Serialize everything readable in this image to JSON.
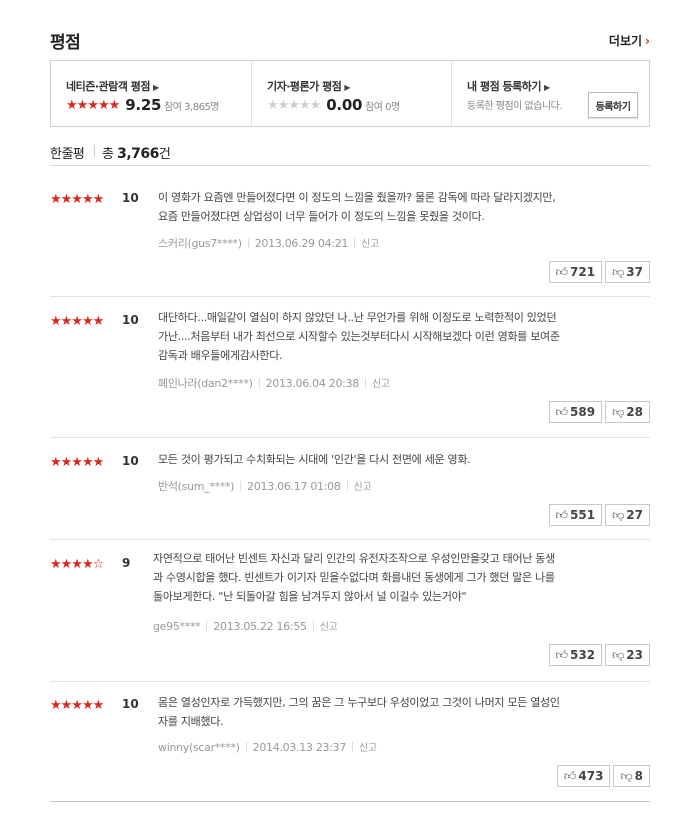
{
  "header": {
    "title": "평점",
    "more": "더보기",
    "more_chev": "›"
  },
  "summary": {
    "audience": {
      "label": "네티즌·관람객 평점",
      "stars": "★★★★★",
      "score": "9.25",
      "participants": "참여 3,865명"
    },
    "critic": {
      "label": "기자·평론가 평점",
      "stars": "★★★★★",
      "score": "0.00",
      "participants": "참여 0명"
    },
    "mine": {
      "label": "내 평점 등록하기",
      "text": "등록한 평점이 없습니다.",
      "button": "등록하기"
    },
    "chev": "›"
  },
  "count": {
    "label": "한줄평",
    "prefix": "총",
    "number": "3,766",
    "suffix": "건"
  },
  "reviews": [
    {
      "stars": "★★★★★",
      "score": "10",
      "lines": [
        "이 영화가 요즘엔 만들어졌다면 이 정도의 느낌을 줬을까? 물론 감독에 따라 달라지겠지만,",
        "요즘 만들어졌다면 상업성이 너무 들어가 이 정도의 느낌을 못줬을 것이다."
      ],
      "user": "스커리(gus7****)",
      "date": "2013.06.29 04:21",
      "report": "신고",
      "likes": "721",
      "dislikes": "37"
    },
    {
      "stars": "★★★★★",
      "score": "10",
      "lines": [
        "대단하다...매일같이 열심이 하지 않았던 나..난 무언가를 위해 이정도로 노력한적이 있었던",
        "가난....처음부터 내가 최선으로 시작할수 있는것부터다시 시작해보겠다 이런 영화를 보여준",
        "감독과 배우들에게감사한다."
      ],
      "user": "폐인나라(dan2****)",
      "date": "2013.06.04 20:38",
      "report": "신고",
      "likes": "589",
      "dislikes": "28"
    },
    {
      "stars": "★★★★★",
      "score": "10",
      "lines": [
        "모든 것이 평가되고 수치화되는 시대에 '인간'을 다시 전면에 세운 영화."
      ],
      "user": "반석(sum_****)",
      "date": "2013.06.17 01:08",
      "report": "신고",
      "likes": "551",
      "dislikes": "27"
    },
    {
      "stars": "★★★★☆",
      "score": "9",
      "lines": [
        "자연적으로 태어난 빈센트 자신과 달리 인간의 유전자조작으로 우성인만을갖고 태어난 동생",
        "과 수영시합을 했다. 빈센트가 이기자 믿을수없다며 화를내던 동생에게 그가 했던 말은 나를",
        "돌아보게한다. \"난 되돌아갈 힘을 남겨두지 않아서 널 이길수 있는거야\""
      ],
      "user": "ge95****",
      "date": "2013.05.22 16:55",
      "report": "신고",
      "likes": "532",
      "dislikes": "23"
    },
    {
      "stars": "★★★★★",
      "score": "10",
      "lines": [
        "몸은 열성인자로 가득했지만, 그의 꿈은 그 누구보다 우성이었고 그것이 나머지 모든 열성인",
        "자를 지배했다."
      ],
      "user": "winny(scar****)",
      "date": "2014.03.13 23:37",
      "report": "신고",
      "likes": "473",
      "dislikes": "8"
    }
  ],
  "icons": {
    "like": "thumbs-up-icon",
    "dislike": "thumbs-down-icon"
  },
  "colors": {
    "accent": "#d9291c",
    "star_gray": "#cfcfcf"
  }
}
